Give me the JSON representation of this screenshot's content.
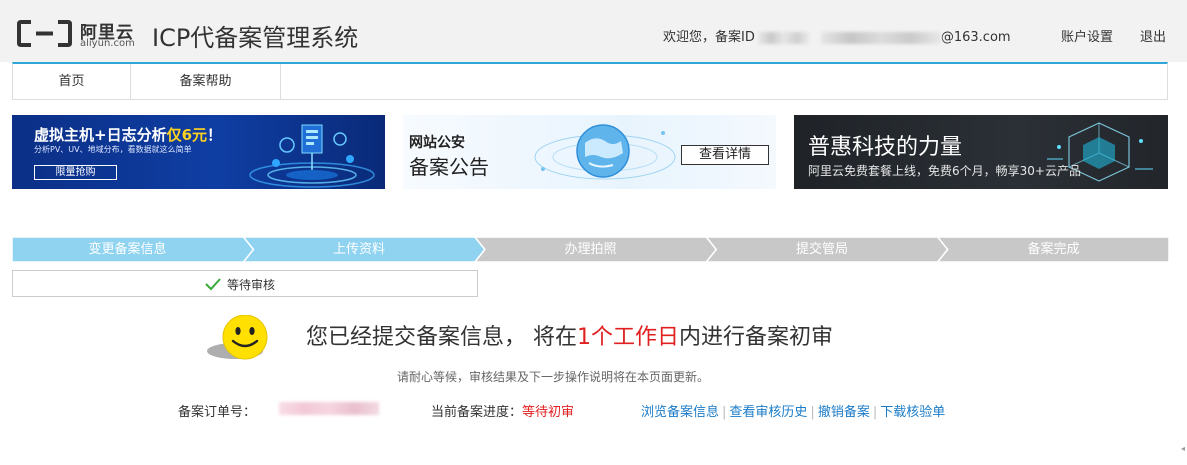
{
  "header": {
    "logo_cn": "阿里云",
    "logo_en": "aliyun.com",
    "system_title": "ICP代备案管理系统",
    "welcome_prefix": "欢迎您，备案ID",
    "email_suffix": "@163.com",
    "account_settings": "账户设置",
    "logout": "退出"
  },
  "nav": {
    "home": "首页",
    "help": "备案帮助"
  },
  "banners": [
    {
      "title": "虚拟主机+日志分析",
      "title_highlight": "仅6元",
      "title_suffix": "！",
      "subtitle": "分析PV、UV、地域分布，看数据就这么简单",
      "button": "限量抢购"
    },
    {
      "title_line1": "网站公安",
      "title_line2": "备案公告",
      "button": "查看详情"
    },
    {
      "title": "普惠科技的力量",
      "subtitle": "阿里云免费套餐上线，免费6个月，畅享30+云产品"
    }
  ],
  "steps": {
    "items": [
      "变更备案信息",
      "上传资料",
      "办理拍照",
      "提交管局",
      "备案完成"
    ],
    "completed_count": 2,
    "color_done": "#8fd3f0",
    "color_todo": "#c8c8c8"
  },
  "status": {
    "text": "等待审核"
  },
  "message": {
    "prefix": "您已经提交备案信息，  将在",
    "highlight": "1个工作日",
    "suffix": "内进行备案初审",
    "sub": "请耐心等候，审核结果及下一步操作说明将在本页面更新。"
  },
  "order": {
    "number_label": "备案订单号：",
    "progress_label": "当前备案进度：",
    "progress_value": "等待初审",
    "links": [
      "浏览备案信息",
      "查看审核历史",
      "撤销备案",
      "下载核验单"
    ]
  },
  "colors": {
    "accent": "#2fa6d7",
    "highlight_red": "#e02020",
    "link_blue": "#1a7bc8"
  }
}
